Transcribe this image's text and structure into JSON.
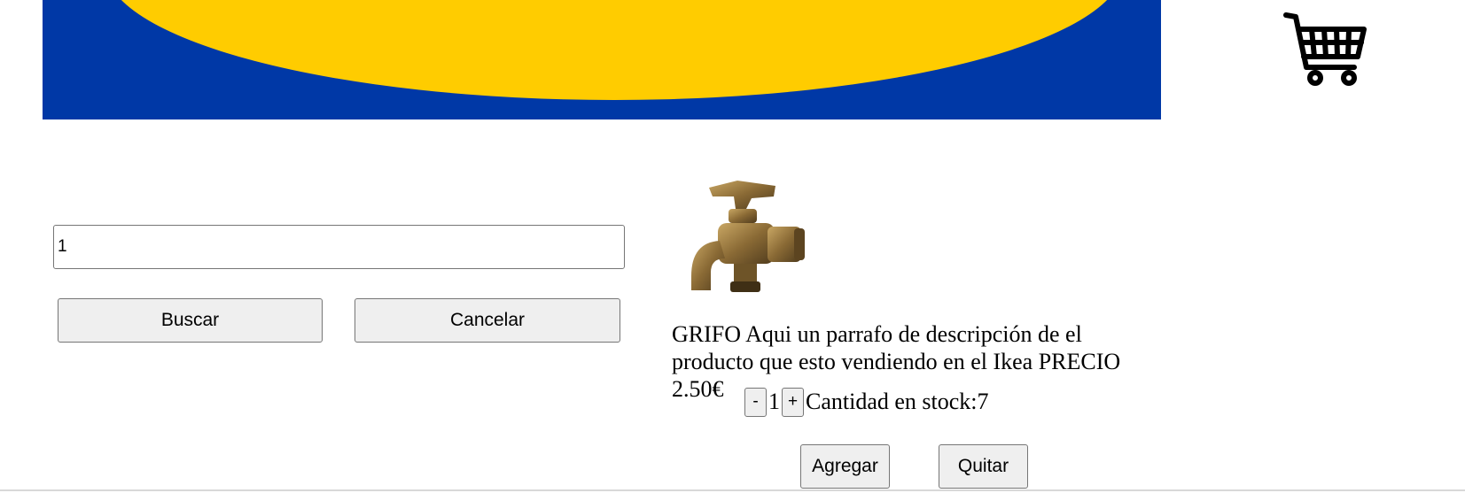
{
  "banner": {
    "background_color": "#0038a6",
    "ellipse_color": "#ffcc00"
  },
  "cart": {
    "icon": "shopping-cart-icon"
  },
  "search": {
    "value": "1",
    "buscar_label": "Buscar",
    "cancelar_label": "Cancelar"
  },
  "product": {
    "image_icon": "faucet-image",
    "description": "GRIFO Aqui un parrafo de descripción de el producto que esto vendiendo en el Ikea PRECIO 2.50€",
    "quantity_minus_label": "-",
    "quantity_value": "1",
    "quantity_plus_label": "+",
    "stock_text": "Cantidad en stock:7",
    "agregar_label": "Agregar",
    "quitar_label": "Quitar"
  }
}
